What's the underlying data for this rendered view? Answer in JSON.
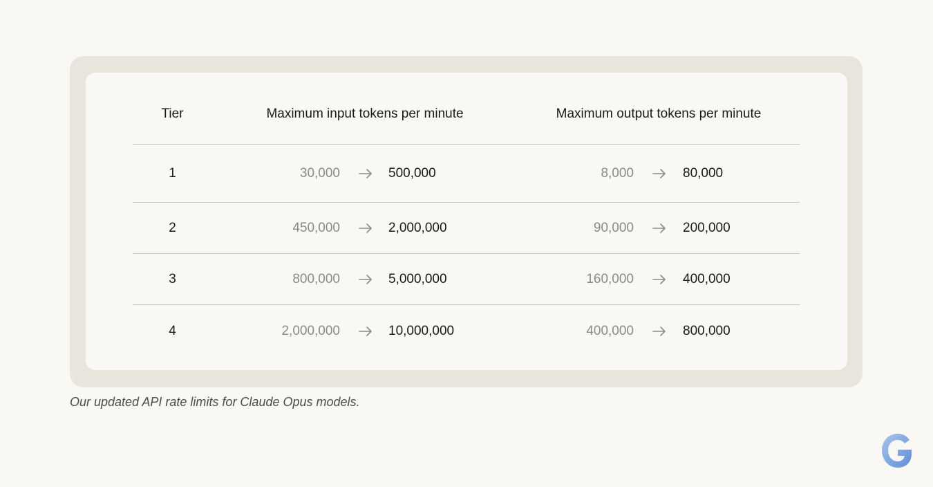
{
  "table": {
    "headers": {
      "tier": "Tier",
      "input": "Maximum input tokens per minute",
      "output": "Maximum output tokens per minute"
    },
    "rows": [
      {
        "tier": "1",
        "input_old": "30,000",
        "input_new": "500,000",
        "output_old": "8,000",
        "output_new": "80,000"
      },
      {
        "tier": "2",
        "input_old": "450,000",
        "input_new": "2,000,000",
        "output_old": "90,000",
        "output_new": "200,000"
      },
      {
        "tier": "3",
        "input_old": "800,000",
        "input_new": "5,000,000",
        "output_old": "160,000",
        "output_new": "400,000"
      },
      {
        "tier": "4",
        "input_old": "2,000,000",
        "input_new": "10,000,000",
        "output_old": "400,000",
        "output_new": "800,000"
      }
    ]
  },
  "caption": "Our updated API rate limits for Claude Opus models.",
  "icons": {
    "arrow": "arrow-right-icon",
    "logo": "g-logo-icon"
  },
  "colors": {
    "background": "#f9f8f4",
    "card_frame": "#e8e6dc",
    "old_value": "#8c8a84",
    "new_value": "#191917",
    "divider": "#c9c7bf"
  }
}
